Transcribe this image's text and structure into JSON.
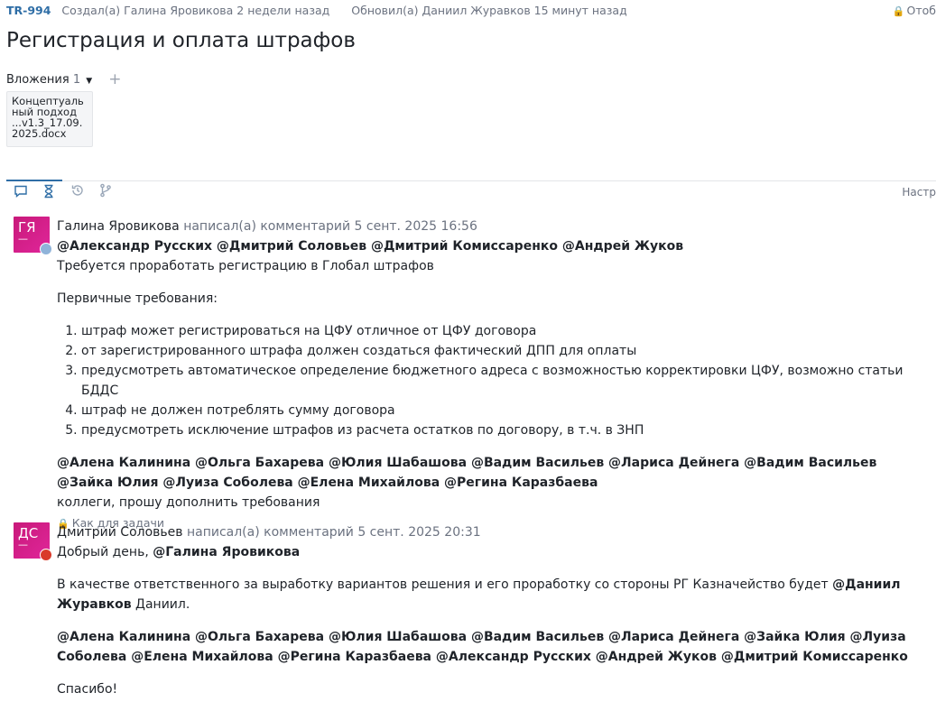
{
  "header": {
    "issue_key": "TR-994",
    "created": "Создал(а) Галина Яровикова 2 недели назад",
    "updated": "Обновил(а) Даниил Журавков 15 минут назад",
    "visibility_label": "Отоб"
  },
  "title": "Регистрация и оплата штрафов",
  "attachments": {
    "label": "Вложения",
    "count": "1",
    "items": [
      {
        "name": "Концептуальный подход ...v1.3_17.09.2025.docx"
      }
    ]
  },
  "tabs": [
    {
      "name": "comments",
      "icon": "comment-icon",
      "active": true
    },
    {
      "name": "time",
      "icon": "hourglass-icon",
      "active": false
    },
    {
      "name": "history",
      "icon": "history-icon",
      "active": false
    },
    {
      "name": "vcs",
      "icon": "branch-icon",
      "active": false
    }
  ],
  "settings_label": "Настр",
  "comments": [
    {
      "author": "Галина Яровикова",
      "initials": "ГЯ",
      "action": "написал(а) комментарий",
      "date": "5 сент. 2025 16:56",
      "mentions_1": "@Александр Русских @Дмитрий Соловьев @Дмитрий Комиссаренко @Андрей Жуков",
      "line_1": "Требуется проработать регистрацию в Глобал штрафов",
      "line_2": "Первичные требования:",
      "list": [
        "штраф может регистрироваться на ЦФУ отличное от ЦФУ договора",
        "от зарегистрированного штрафа должен создаться фактический ДПП для оплаты",
        "предусмотреть автоматическое определение бюджетного адреса с возможностью корректировки ЦФУ, возможно статьи БДДС",
        "штраф не должен потреблять сумму договора",
        "предусмотреть исключение штрафов из расчета остатков по договору, в т.ч. в ЗНП"
      ],
      "mentions_2": "@Алена Калинина @Ольга Бахарева @Юлия Шабашова @Вадим Васильев @Лариса Дейнега @Вадим Васильев @Зайка Юлия @Луиза Соболева @Елена Михайлова @Регина Каразбаева",
      "line_3": "коллеги, прошу дополнить требования",
      "restricted": "Как для задачи"
    },
    {
      "author": "Дмитрий Соловьев",
      "initials": "ДС",
      "action": "написал(а) комментарий",
      "date": "5 сент. 2025 20:31",
      "greeting": "Добрый день,",
      "greeting_mention": "@Галина Яровикова",
      "line_1": "В качестве ответственного за выработку вариантов решения и его проработку со стороны РГ Казначейство будет",
      "line_1_mention": "@Даниил Журавков",
      "line_1_tail": "Даниил.",
      "mentions_2": "@Алена Калинина @Ольга Бахарева @Юлия Шабашова @Вадим Васильев @Лариса Дейнега  @Зайка Юлия @Луиза Соболева @Елена Михайлова @Регина Каразбаева @Александр Русских @Андрей Жуков @Дмитрий Комиссаренко",
      "thanks": "Спасибо!"
    }
  ],
  "colors": {
    "accent": "#2f6ea6",
    "avatar": "#d01f8a"
  }
}
